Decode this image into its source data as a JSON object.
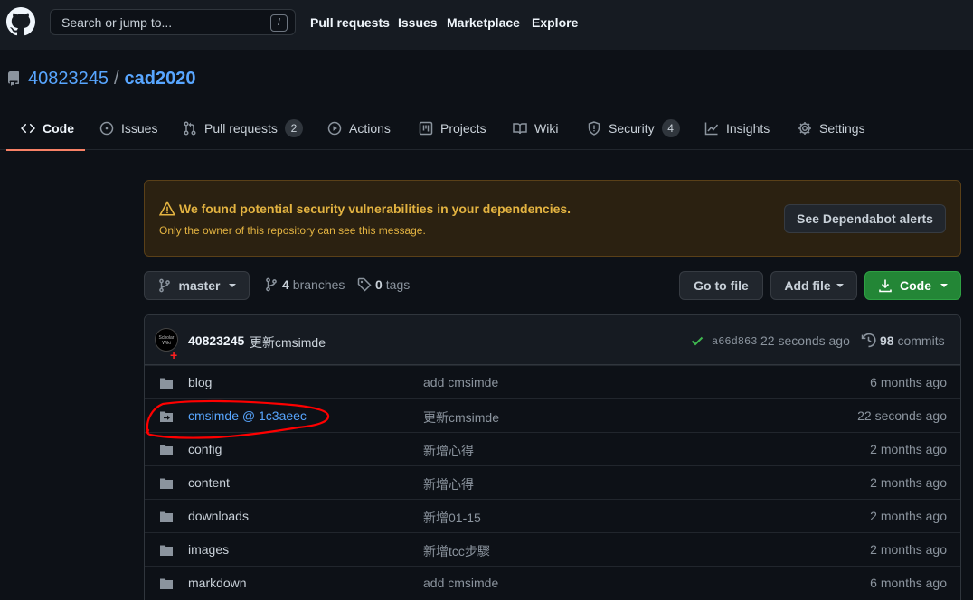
{
  "header": {
    "search_placeholder": "Search or jump to...",
    "search_shortcut": "/",
    "nav": [
      "Pull requests",
      "Issues",
      "Marketplace",
      "Explore"
    ],
    "logo_icon": "github-mark-icon"
  },
  "repo": {
    "owner": "40823245",
    "separator": "/",
    "name": "cad2020"
  },
  "tabs": [
    {
      "label": "Code",
      "icon": "code-icon",
      "active": true
    },
    {
      "label": "Issues",
      "icon": "issue-icon"
    },
    {
      "label": "Pull requests",
      "icon": "pull-request-icon",
      "count": "2"
    },
    {
      "label": "Actions",
      "icon": "play-icon"
    },
    {
      "label": "Projects",
      "icon": "project-icon"
    },
    {
      "label": "Wiki",
      "icon": "book-icon"
    },
    {
      "label": "Security",
      "icon": "shield-icon",
      "count": "4"
    },
    {
      "label": "Insights",
      "icon": "graph-icon"
    },
    {
      "label": "Settings",
      "icon": "gear-icon"
    }
  ],
  "alert": {
    "title": "We found potential security vulnerabilities in your dependencies.",
    "subtitle": "Only the owner of this repository can see this message.",
    "button": "See Dependabot alerts",
    "color": "#e3b341"
  },
  "branch_bar": {
    "branch": "master",
    "branches_count": "4",
    "branches_label": "branches",
    "tags_count": "0",
    "tags_label": "tags",
    "goto_file": "Go to file",
    "add_file": "Add file",
    "code": "Code"
  },
  "latest_commit": {
    "author": "40823245",
    "message": "更新cmsimde",
    "sha": "a66d863",
    "time": "22 seconds ago",
    "commit_count": "98",
    "commits_label": "commits",
    "status": "success",
    "avatar_text": "Scholar Wiki"
  },
  "files": [
    {
      "name": "blog",
      "type": "folder",
      "message": "add cmsimde",
      "time": "6 months ago"
    },
    {
      "name": "cmsimde @ 1c3aeec",
      "type": "submodule",
      "message": "更新cmsimde",
      "time": "22 seconds ago"
    },
    {
      "name": "config",
      "type": "folder",
      "message": "新增心得",
      "time": "2 months ago"
    },
    {
      "name": "content",
      "type": "folder",
      "message": "新增心得",
      "time": "2 months ago"
    },
    {
      "name": "downloads",
      "type": "folder",
      "message": "新增01-15",
      "time": "2 months ago"
    },
    {
      "name": "images",
      "type": "folder",
      "message": "新增tcc步驟",
      "time": "2 months ago"
    },
    {
      "name": "markdown",
      "type": "folder",
      "message": "add cmsimde",
      "time": "6 months ago"
    }
  ],
  "colors": {
    "background": "#0d1117",
    "header": "#161b22",
    "link": "#58a6ff",
    "accent_tab": "#f78166",
    "code_button": "#238636",
    "annotation": "#ff0000"
  }
}
